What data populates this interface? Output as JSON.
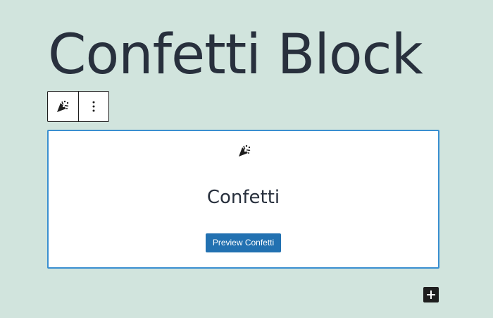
{
  "page": {
    "title": "Confetti Block"
  },
  "toolbar": {
    "block_icon": "party-popper-icon",
    "options_icon": "vertical-ellipsis-icon"
  },
  "block": {
    "icon": "party-popper-icon",
    "heading": "Confetti",
    "button_label": "Preview Confetti"
  },
  "inserter": {
    "icon": "plus-icon"
  },
  "colors": {
    "background": "#d1e4dd",
    "text": "#28303d",
    "block_border": "#3a8fd0",
    "button": "#2271b1"
  }
}
